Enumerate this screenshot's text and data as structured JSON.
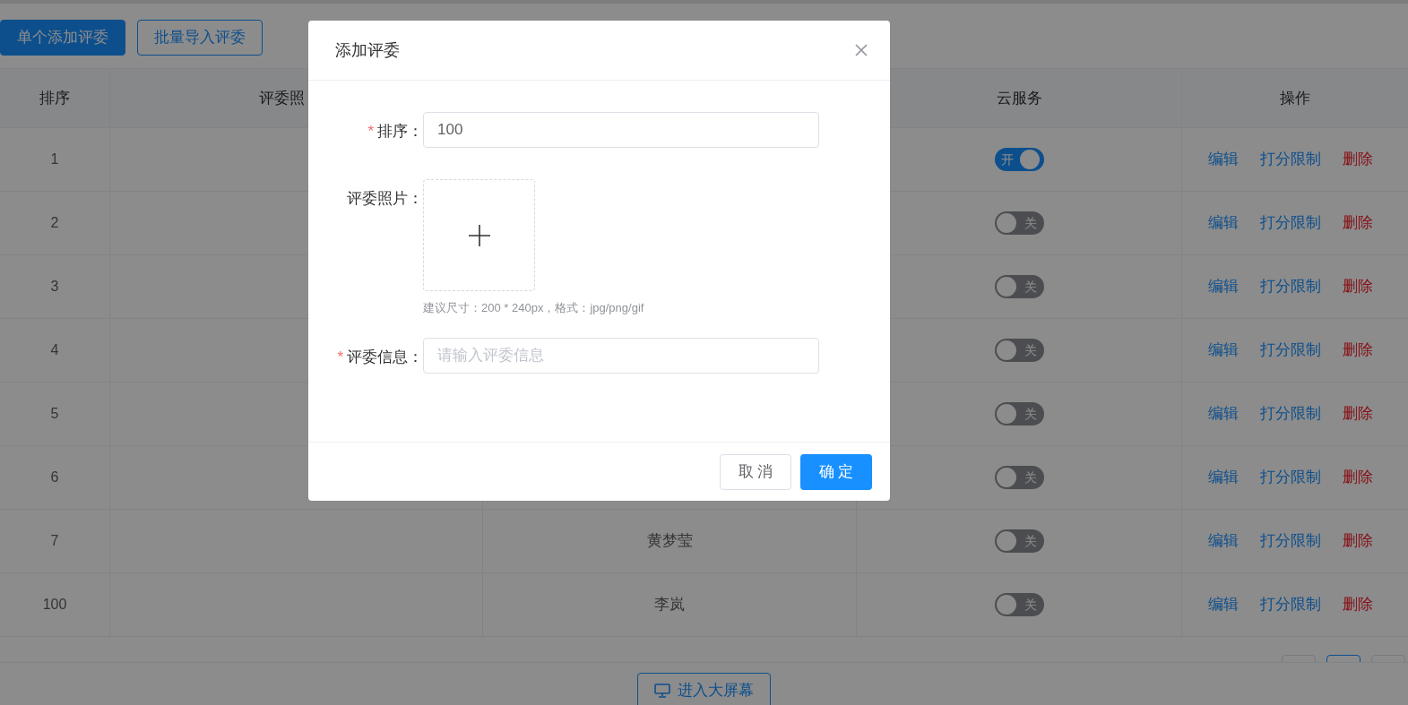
{
  "toolbar": {
    "buttons": [
      {
        "label": "单个添加评委",
        "kind": "primary"
      },
      {
        "label": "批量导入评委",
        "kind": "outline"
      }
    ]
  },
  "table": {
    "columns": [
      "排序",
      "评委照",
      "",
      "云服务",
      "操作"
    ],
    "rows": [
      {
        "order": "1",
        "cloud_service": {
          "on": true,
          "label": "开"
        },
        "actions": [
          {
            "label": "编辑",
            "kind": "link"
          },
          {
            "label": "打分限制",
            "kind": "link"
          },
          {
            "label": "删除",
            "kind": "danger"
          }
        ]
      },
      {
        "order": "2",
        "cloud_service": {
          "on": false,
          "label": "关"
        },
        "actions": [
          {
            "label": "编辑",
            "kind": "link"
          },
          {
            "label": "打分限制",
            "kind": "link"
          },
          {
            "label": "删除",
            "kind": "danger"
          }
        ]
      },
      {
        "order": "3",
        "cloud_service": {
          "on": false,
          "label": "关"
        },
        "actions": [
          {
            "label": "编辑",
            "kind": "link"
          },
          {
            "label": "打分限制",
            "kind": "link"
          },
          {
            "label": "删除",
            "kind": "danger"
          }
        ]
      },
      {
        "order": "4",
        "cloud_service": {
          "on": false,
          "label": "关"
        },
        "actions": [
          {
            "label": "编辑",
            "kind": "link"
          },
          {
            "label": "打分限制",
            "kind": "link"
          },
          {
            "label": "删除",
            "kind": "danger"
          }
        ]
      },
      {
        "order": "5",
        "cloud_service": {
          "on": false,
          "label": "关"
        },
        "actions": [
          {
            "label": "编辑",
            "kind": "link"
          },
          {
            "label": "打分限制",
            "kind": "link"
          },
          {
            "label": "删除",
            "kind": "danger"
          }
        ]
      },
      {
        "order": "6",
        "cloud_service": {
          "on": false,
          "label": "关"
        },
        "actions": [
          {
            "label": "编辑",
            "kind": "link"
          },
          {
            "label": "打分限制",
            "kind": "link"
          },
          {
            "label": "删除",
            "kind": "danger"
          }
        ]
      },
      {
        "order": "7",
        "name": "黄梦莹",
        "cloud_service": {
          "on": false,
          "label": "关"
        },
        "actions": [
          {
            "label": "编辑",
            "kind": "link"
          },
          {
            "label": "打分限制",
            "kind": "link"
          },
          {
            "label": "删除",
            "kind": "danger"
          }
        ]
      },
      {
        "order": "100",
        "name": "李岚",
        "cloud_service": {
          "on": false,
          "label": "关"
        },
        "actions": [
          {
            "label": "编辑",
            "kind": "link"
          },
          {
            "label": "打分限制",
            "kind": "link"
          },
          {
            "label": "删除",
            "kind": "danger"
          }
        ]
      }
    ]
  },
  "pagination": {
    "pages": [
      {
        "selected": false
      },
      {
        "selected": true
      },
      {
        "selected": false
      }
    ]
  },
  "big_screen_button": {
    "label": "进入大屏幕"
  },
  "dialog": {
    "title": "添加评委",
    "fields": [
      {
        "kind": "input",
        "required_mark": "*",
        "label": "排序：",
        "value": "100"
      },
      {
        "kind": "upload",
        "label": "评委照片：",
        "hint": "建议尺寸：200 * 240px，格式：jpg/png/gif"
      },
      {
        "kind": "input",
        "required_mark": "*",
        "label": "评委信息：",
        "placeholder": "请输入评委信息"
      }
    ],
    "buttons": [
      {
        "label": "取 消",
        "kind": "default"
      },
      {
        "label": "确 定",
        "kind": "primary"
      }
    ]
  }
}
